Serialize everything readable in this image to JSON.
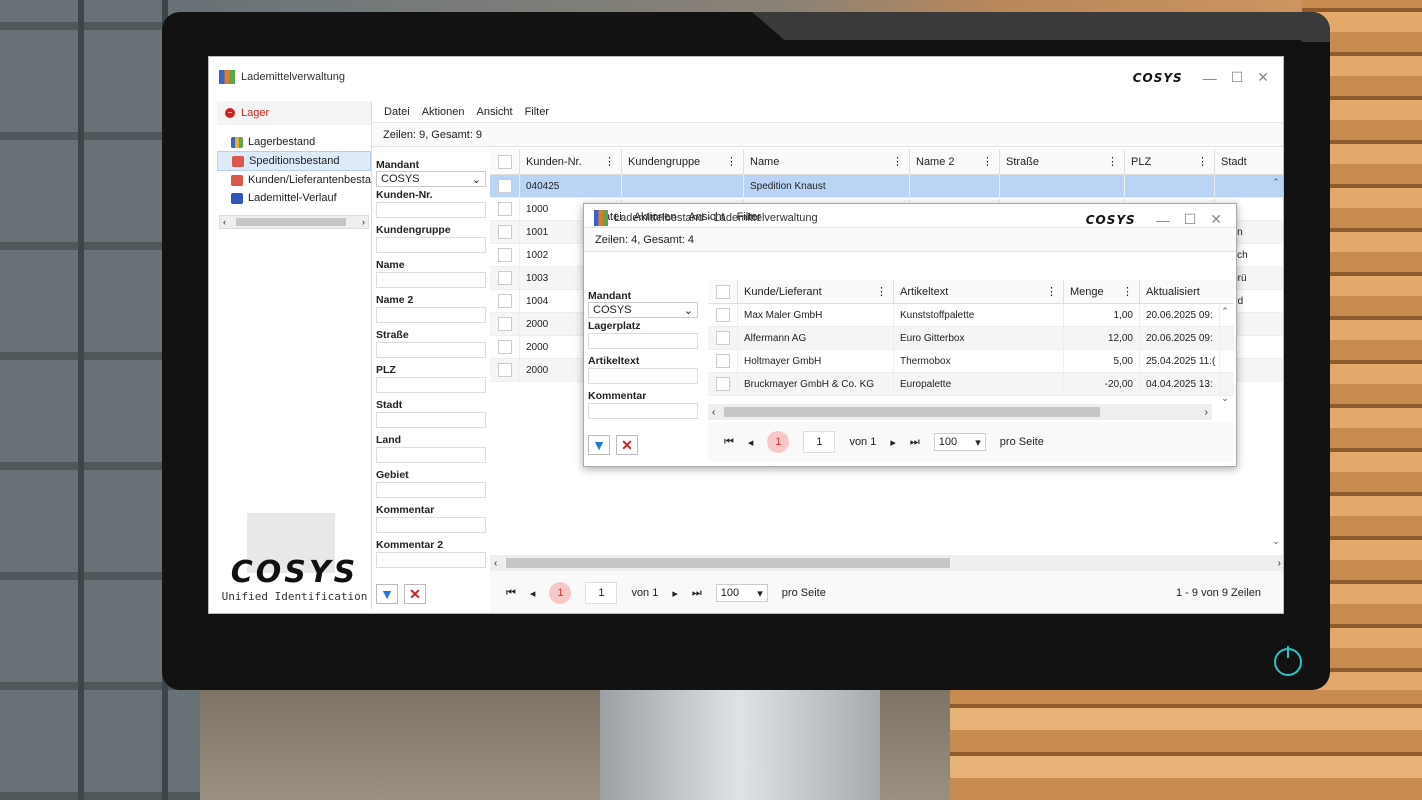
{
  "window": {
    "title": "Lademittelverwaltung",
    "brand": "COSYS"
  },
  "sidebar": {
    "section": "Lager",
    "items": [
      {
        "label": "Lagerbestand"
      },
      {
        "label": "Speditionsbestand"
      },
      {
        "label": "Kunden/Lieferantenbestand"
      },
      {
        "label": "Lademittel-Verlauf"
      }
    ],
    "logo": "COSYS",
    "tagline": "Unified Identification"
  },
  "menu": [
    "Datei",
    "Aktionen",
    "Ansicht",
    "Filter"
  ],
  "main": {
    "rows_info": "Zeilen: 9, Gesamt: 9",
    "filter": {
      "mandant_label": "Mandant",
      "mandant_value": "COSYS",
      "fields": [
        "Kunden-Nr.",
        "Kundengruppe",
        "Name",
        "Name 2",
        "Straße",
        "PLZ",
        "Stadt",
        "Land",
        "Gebiet",
        "Kommentar",
        "Kommentar 2"
      ]
    },
    "columns": [
      "Kunden-Nr.",
      "Kundengruppe",
      "Name",
      "Name 2",
      "Straße",
      "PLZ",
      "Stadt"
    ],
    "rows": [
      [
        "040425",
        "",
        "Spedition Knaust",
        "",
        "",
        "",
        ""
      ],
      [
        "1000",
        "",
        "",
        "",
        "",
        "",
        "he"
      ],
      [
        "1001",
        "",
        "",
        "",
        "",
        "",
        "sden"
      ],
      [
        "1002",
        "",
        "",
        "",
        "",
        "",
        "unsch"
      ],
      [
        "1003",
        "",
        "",
        "",
        "",
        "",
        "nabrü"
      ],
      [
        "1004",
        "",
        "",
        "",
        "",
        "",
        "rnold"
      ],
      [
        "2000",
        "",
        "",
        "",
        "",
        "",
        ""
      ],
      [
        "2000",
        "",
        "",
        "",
        "",
        "",
        ""
      ],
      [
        "2000",
        "",
        "",
        "",
        "",
        "",
        ""
      ]
    ],
    "pager": {
      "page": "1",
      "page_input": "1",
      "of": "von 1",
      "per_page": "100",
      "per_label": "pro Seite",
      "info": "1 - 9 von 9 Zeilen"
    }
  },
  "dialog": {
    "title": "Lademittelbestand - Lademittelverwaltung",
    "brand": "COSYS",
    "rows_info": "Zeilen: 4, Gesamt: 4",
    "filter": {
      "mandant_label": "Mandant",
      "mandant_value": "COSYS",
      "fields": [
        "Lagerplatz",
        "Artikeltext",
        "Kommentar"
      ]
    },
    "columns": [
      "Kunde/Lieferant",
      "Artikeltext",
      "Menge",
      "Aktualisiert"
    ],
    "rows": [
      [
        "Max Maler GmbH",
        "Kunststoffpalette",
        "1,00",
        "20.06.2025 09:"
      ],
      [
        "Alfermann AG",
        "Euro Gitterbox",
        "12,00",
        "20.06.2025 09:"
      ],
      [
        "Holtmayer GmbH",
        "Thermobox",
        "5,00",
        "25.04.2025 11:("
      ],
      [
        "Bruckmayer GmbH & Co. KG",
        "Europalette",
        "-20,00",
        "04.04.2025 13:"
      ]
    ],
    "pager": {
      "page": "1",
      "page_input": "1",
      "of": "von 1",
      "per_page": "100",
      "per_label": "pro Seite"
    }
  }
}
